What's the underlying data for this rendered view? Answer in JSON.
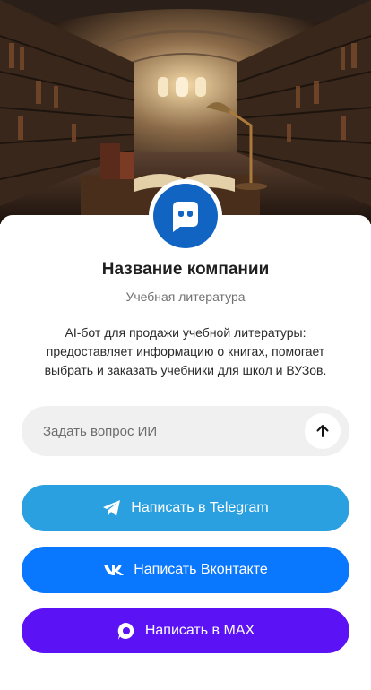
{
  "hero": {
    "image": "library-hall-illustration"
  },
  "company": {
    "avatar_icon": "chat-bot-icon",
    "name": "Название компании",
    "category": "Учебная литература",
    "description": "AI-бот для продажи учебной литературы: предоставляет информацию о книгах, помогает выбрать и заказать учебники для школ и ВУЗов."
  },
  "ask": {
    "placeholder": "Задать вопрос ИИ",
    "value": "",
    "send_icon": "arrow-up-icon"
  },
  "buttons": [
    {
      "label": "Написать в Telegram",
      "icon": "telegram-icon",
      "color": "#2aa0e0"
    },
    {
      "label": "Написать Вконтакте",
      "icon": "vk-icon",
      "color": "#0a77ff"
    },
    {
      "label": "Написать в MAX",
      "icon": "max-icon",
      "color": "#5b12f4"
    }
  ],
  "colors": {
    "accent": "#1264c3"
  }
}
